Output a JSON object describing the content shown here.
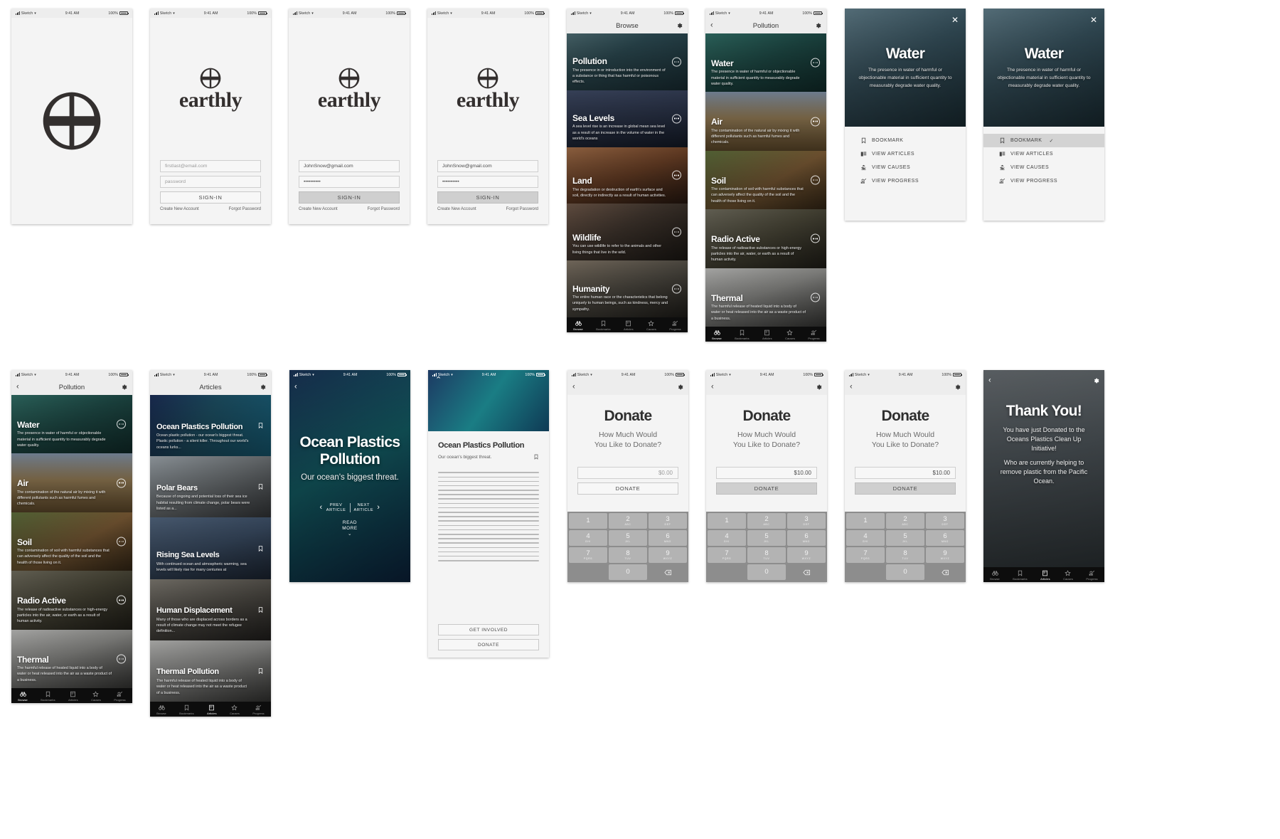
{
  "status_bar": {
    "carrier": "Sketch",
    "time": "9:41 AM",
    "battery": "100%"
  },
  "brand": {
    "name": "earthly"
  },
  "signin": {
    "email_placeholder": "firstlast@email.com",
    "password_placeholder": "password",
    "email_value": "JohnSnow@gmail.com",
    "password_value": "••••••••••",
    "sign_in_label": "SIGN-IN",
    "create_account_label": "Create New Account",
    "forgot_password_label": "Forgot Password"
  },
  "browse": {
    "title": "Browse",
    "cards": [
      {
        "title": "Pollution",
        "desc": "The presence in or introduction into the environment of a substance or thing that has harmful or poisonous effects."
      },
      {
        "title": "Sea Levels",
        "desc": "A sea level rise is an increase in global mean sea level as a result of an increase in the volume of water in the world's oceans"
      },
      {
        "title": "Land",
        "desc": "The degradation or destruction of earth's surface and soil, directly or indirectly as a result of human activities."
      },
      {
        "title": "Wildlife",
        "desc": "You can use wildlife to refer to the animals and other living things that live in the wild."
      },
      {
        "title": "Humanity",
        "desc": "The entire human race or the characteristics that belong uniquely to human beings, such as kindness, mercy and sympathy."
      }
    ]
  },
  "pollution": {
    "title": "Pollution",
    "cards": [
      {
        "title": "Water",
        "desc": "The presence in water of harmful or objectionable material in sufficient quantity to measurably degrade water quality."
      },
      {
        "title": "Air",
        "desc": "The contamination of the natural air by mixing it with different pollutants such as harmful fumes and chemicals."
      },
      {
        "title": "Soil",
        "desc": "The contamination of soil with harmful substances that can adversely affect the quality of the soil and the health of those living on it."
      },
      {
        "title": "Radio Active",
        "desc": "The release of radioactive substances or high-energy particles into the air, water, or earth as a result of human activity."
      },
      {
        "title": "Thermal",
        "desc": "The harmful release of heated liquid into a body of water or heat released into the air as a waste product of a business."
      }
    ]
  },
  "water_modal": {
    "title": "Water",
    "desc": "The presence in water of harmful or objectionable material in sufficient quantity to measurably degrade water quality.",
    "close_icon": "close-icon",
    "actions": [
      {
        "label": "BOOKMARK",
        "icon": "bookmark-icon",
        "checked": false
      },
      {
        "label": "VIEW ARTICLES",
        "icon": "articles-icon",
        "checked": false
      },
      {
        "label": "VIEW CAUSES",
        "icon": "causes-icon",
        "checked": false
      },
      {
        "label": "VIEW PROGRESS",
        "icon": "progress-icon",
        "checked": false
      }
    ],
    "bookmark_check": "✓"
  },
  "articles": {
    "title": "Articles",
    "cards": [
      {
        "title": "Ocean Plastics Pollution",
        "desc": "Ocean plastic pollution - our ocean's biggest threat. Plastic pollution - a silent killer. Throughout our world's oceans lurks..."
      },
      {
        "title": "Polar Bears",
        "desc": "Because of ongoing and potential loss of their sea ice habitat resulting from climate change, polar bears were listed as a..."
      },
      {
        "title": "Rising Sea Levels",
        "desc": "With continued ocean and atmospheric warming, sea levels will likely rise for many centuries at"
      },
      {
        "title": "Human Displacement",
        "desc": "Many of those who are displaced across borders as a result of climate change may not meet the refugee definition..."
      },
      {
        "title": "Thermal Pollution",
        "desc": "The harmful release of heated liquid into a body of water or heat released into the air as a waste product of a business."
      }
    ]
  },
  "hero_article": {
    "title": "Ocean Plastics Pollution",
    "subtitle": "Our ocean's biggest threat.",
    "prev_label": "PREV\nARTICLE",
    "prev_line1": "PREV",
    "prev_line2": "ARTICLE",
    "next_line1": "NEXT",
    "next_line2": "ARTICLE",
    "read_more_line1": "READ",
    "read_more_line2": "MORE"
  },
  "reader": {
    "title": "Ocean Plastics Pollution",
    "subtitle": "Our ocean's biggest threat.",
    "get_involved_label": "GET INVOLVED",
    "donate_label": "DONATE"
  },
  "donate": {
    "title": "Donate",
    "question_line1": "How Much Would",
    "question_line2": "You Like to Donate?",
    "amount_placeholder": "$0.00",
    "amount_value": "$10.00",
    "button_label": "DONATE",
    "keypad": [
      {
        "num": "1",
        "letters": ""
      },
      {
        "num": "2",
        "letters": "ABC"
      },
      {
        "num": "3",
        "letters": "DEF"
      },
      {
        "num": "4",
        "letters": "GHI"
      },
      {
        "num": "5",
        "letters": "JKL"
      },
      {
        "num": "6",
        "letters": "MNO"
      },
      {
        "num": "7",
        "letters": "PQRS"
      },
      {
        "num": "8",
        "letters": "TUV"
      },
      {
        "num": "9",
        "letters": "WXYZ"
      },
      {
        "num": "0",
        "letters": ""
      }
    ],
    "delete_icon": "backspace-icon"
  },
  "thank_you": {
    "title": "Thank You!",
    "paragraph1": "You have just Donated to the Oceans Plastics Clean Up Initiative!",
    "paragraph2": "Who are currently helping to remove plastic from the Pacific Ocean."
  },
  "tabbar": {
    "items": [
      {
        "label": "Browse",
        "icon": "binoculars-icon"
      },
      {
        "label": "Bookmarks",
        "icon": "bookmark-icon"
      },
      {
        "label": "Articles",
        "icon": "book-icon"
      },
      {
        "label": "Causes",
        "icon": "star-icon"
      },
      {
        "label": "Progress",
        "icon": "chart-icon"
      }
    ]
  },
  "colors": {
    "page_bg": "#ffffff",
    "screen_bg": "#f4f4f4",
    "navbar_bg": "#ededed",
    "tabbar_bg": "#0d0d0d",
    "ink": "#332f2e",
    "keypad_bg": "#8d8d8d",
    "key_bg": "#b3b3b3"
  }
}
